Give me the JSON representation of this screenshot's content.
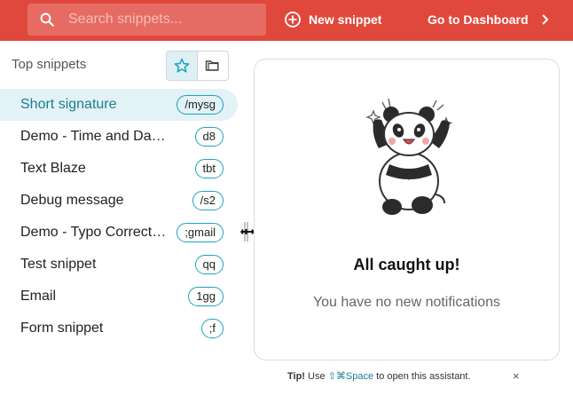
{
  "colors": {
    "brand": "#e0483c",
    "accent": "#1ba3bd",
    "active_text": "#1b7d92",
    "active_bg": "#e3f2f6"
  },
  "topbar": {
    "search": {
      "placeholder": "Search snippets...",
      "icon": "search-icon"
    },
    "new_snippet": {
      "label": "New snippet",
      "icon": "plus-circle-icon"
    },
    "dashboard": {
      "label": "Go to Dashboard",
      "icon": "chevron-right-icon"
    }
  },
  "sidebar": {
    "title": "Top snippets",
    "toggle": [
      {
        "icon": "star-icon",
        "active": true
      },
      {
        "icon": "folder-icon",
        "active": false
      }
    ],
    "snippets": [
      {
        "name": "Short signature",
        "shortcut": "/mysg",
        "active": true
      },
      {
        "name": "Demo - Time and Dates",
        "shortcut": "d8",
        "active": false
      },
      {
        "name": "Text Blaze",
        "shortcut": "tbt",
        "active": false
      },
      {
        "name": "Debug message",
        "shortcut": "/s2",
        "active": false
      },
      {
        "name": "Demo - Typo Correct…",
        "shortcut": ";gmail",
        "active": false
      },
      {
        "name": "Test snippet",
        "shortcut": "qq",
        "active": false
      },
      {
        "name": "Email",
        "shortcut": "1gg",
        "active": false
      },
      {
        "name": "Form snippet",
        "shortcut": ";f",
        "active": false
      }
    ]
  },
  "notifications": {
    "title": "All caught up!",
    "subtitle": "You have no new notifications",
    "illustration": "panda-illustration"
  },
  "tip": {
    "label": "Tip!",
    "before": "Use",
    "keys": "⇧⌘Space",
    "after": "to open this assistant.",
    "close": "×"
  }
}
